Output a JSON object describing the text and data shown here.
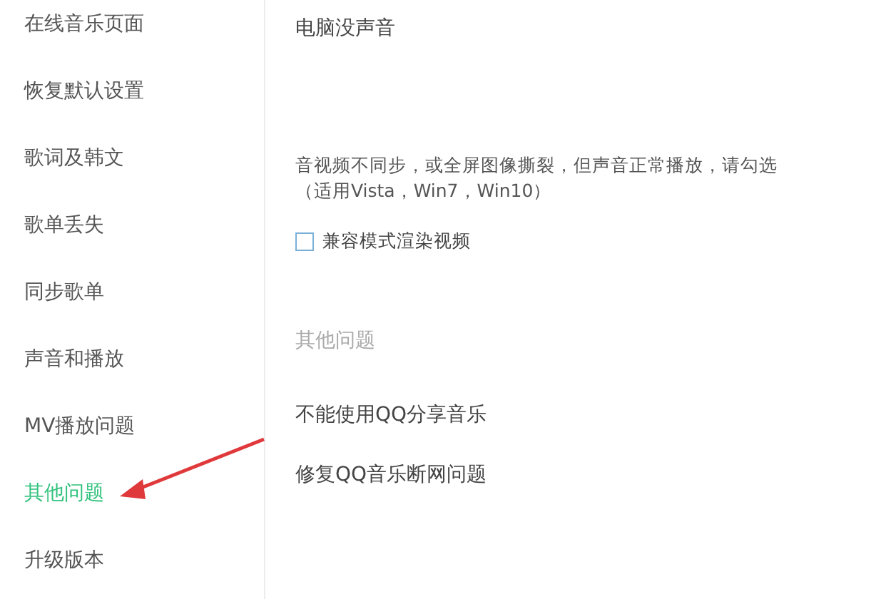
{
  "sidebar": {
    "items": [
      {
        "label": "在线音乐页面",
        "selected": false
      },
      {
        "label": "恢复默认设置",
        "selected": false
      },
      {
        "label": "歌词及韩文",
        "selected": false
      },
      {
        "label": "歌单丢失",
        "selected": false
      },
      {
        "label": "同步歌单",
        "selected": false
      },
      {
        "label": "声音和播放",
        "selected": false
      },
      {
        "label": "MV播放问题",
        "selected": false
      },
      {
        "label": "其他问题",
        "selected": true
      },
      {
        "label": "升级版本",
        "selected": false
      }
    ]
  },
  "content": {
    "top_item": "电脑没声音",
    "description": [
      "音视频不同步，或全屏图像撕裂，但声音正常播放，请勾选",
      "（适用Vista，Win7，Win10）"
    ],
    "checkbox": {
      "label": "兼容模式渲染视频",
      "checked": false
    },
    "section_heading": "其他问题",
    "items": [
      "不能使用QQ分享音乐",
      "修复QQ音乐断网问题"
    ]
  }
}
